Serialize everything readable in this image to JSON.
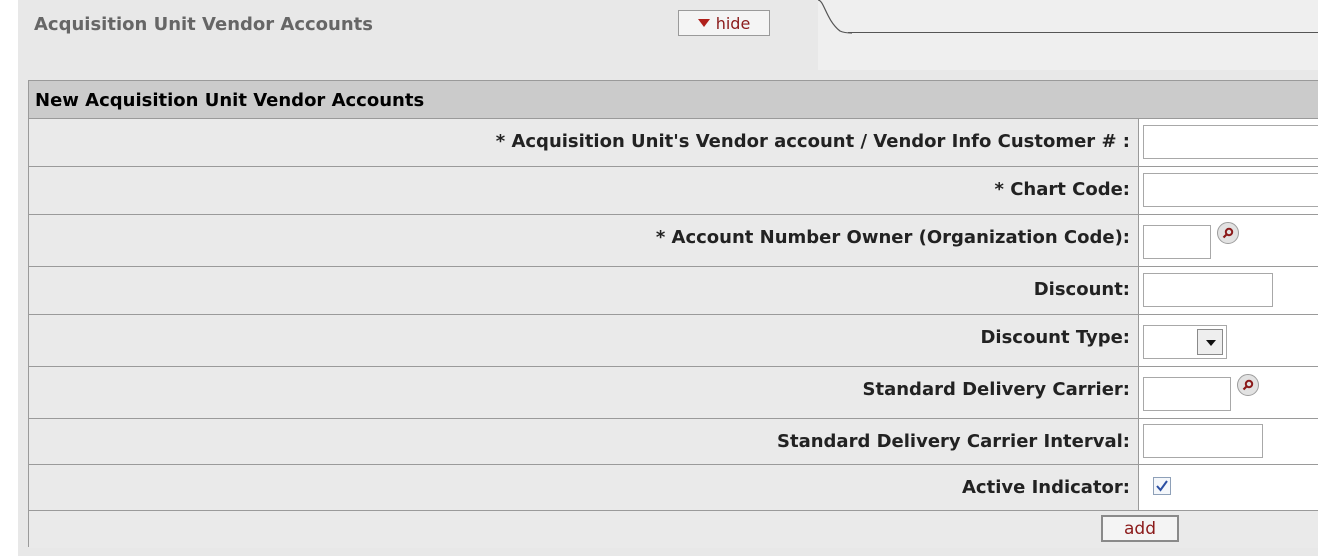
{
  "header": {
    "title": "Acquisition Unit Vendor Accounts",
    "hide_label": "hide"
  },
  "section": {
    "title": "New Acquisition Unit Vendor Accounts"
  },
  "fields": [
    {
      "label": "*  Acquisition Unit's Vendor account / Vendor Info Customer # :",
      "value": ""
    },
    {
      "label": "*  Chart Code:",
      "value": ""
    },
    {
      "label": "*  Account Number Owner (Organization Code):",
      "value": ""
    },
    {
      "label": "Discount:",
      "value": ""
    },
    {
      "label": "Discount Type:",
      "value": ""
    },
    {
      "label": "Standard Delivery Carrier:",
      "value": ""
    },
    {
      "label": "Standard Delivery Carrier Interval:",
      "value": ""
    },
    {
      "label": "Active Indicator:",
      "checked": true
    }
  ],
  "actions": {
    "add_label": "add"
  },
  "colors": {
    "accent": "#8b1a1a",
    "row_bg": "#eaeaea",
    "header_bg": "#cbcbcb"
  },
  "icons": {
    "lookup": "magnifier-icon",
    "hide": "triangle-down-icon",
    "dropdown": "chevron-down-icon",
    "check": "checkmark-icon"
  }
}
